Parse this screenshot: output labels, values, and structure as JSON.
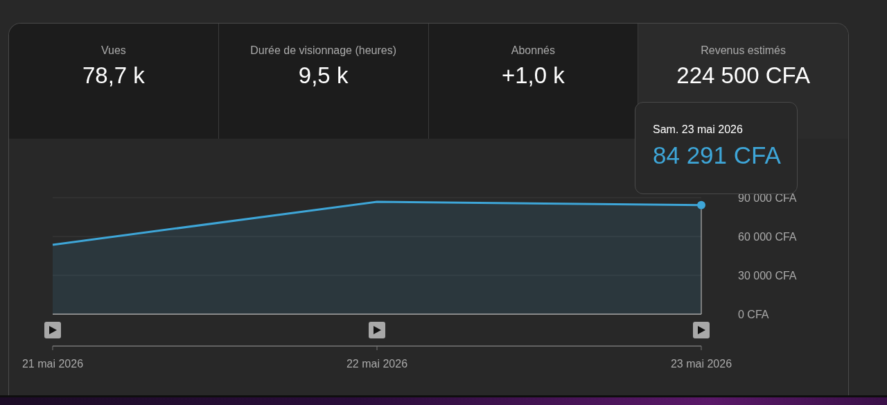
{
  "metric_tabs": [
    {
      "label": "Vues",
      "value": "78,7 k",
      "selected": false
    },
    {
      "label": "Durée de visionnage (heures)",
      "value": "9,5 k",
      "selected": false
    },
    {
      "label": "Abonnés",
      "value": "+1,0 k",
      "selected": false
    },
    {
      "label": "Revenus estimés",
      "value": "224 500 CFA",
      "selected": true
    }
  ],
  "chart": {
    "tooltip": {
      "date": "Sam. 23 mai 2026",
      "value": "84 291 CFA"
    },
    "chart_data": {
      "type": "area",
      "categories": [
        "21 mai 2026",
        "22 mai 2026",
        "23 mai 2026"
      ],
      "series": [
        {
          "color": "#3ea6d8",
          "values": [
            53600,
            86800,
            84291
          ]
        }
      ],
      "ylim": [
        0,
        90000
      ],
      "yticks": [
        {
          "value": 0,
          "label": "0 CFA"
        },
        {
          "value": 30000,
          "label": "30 000 CFA"
        },
        {
          "value": 60000,
          "label": "60 000 CFA"
        },
        {
          "value": 90000,
          "label": "90 000 CFA"
        }
      ]
    }
  }
}
